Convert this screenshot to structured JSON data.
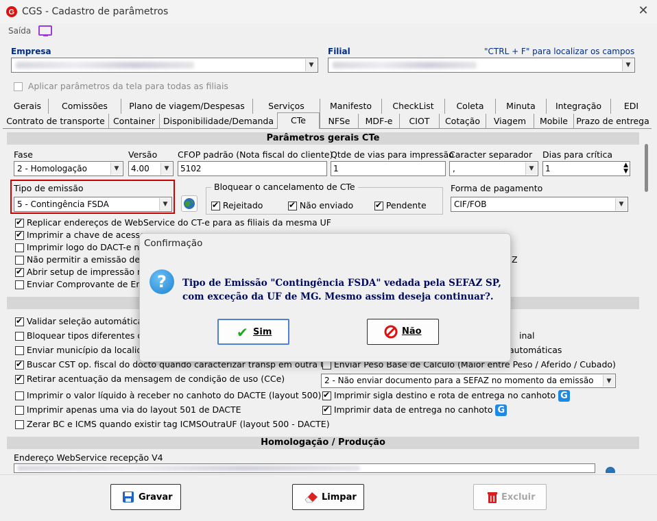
{
  "window": {
    "title": "CGS - Cadastro de parâmetros",
    "close": "✕"
  },
  "menu": {
    "saida": "Saída"
  },
  "empresa": {
    "label": "Empresa"
  },
  "filial": {
    "label": "Filial",
    "hint": "\"CTRL + F\" para localizar os campos"
  },
  "apply_all": {
    "label": "Aplicar parâmetros da tela para todas as filiais"
  },
  "tabs_row1": [
    "Gerais",
    "Comissões",
    "Plano de viagem/Despesas",
    "Serviços",
    "Manifesto",
    "CheckList",
    "Coleta",
    "Minuta",
    "Integração",
    "EDI"
  ],
  "tabs_row2": [
    "Contrato de transporte",
    "Container",
    "Disponibilidade/Demanda",
    "CTe",
    "NFSe",
    "MDF-e",
    "CIOT",
    "Cotação",
    "Viagem",
    "Mobile",
    "Prazo de entrega"
  ],
  "section_cte": "Parâmetros gerais CTe",
  "fase": {
    "label": "Fase",
    "value": "2 - Homologação"
  },
  "versao": {
    "label": "Versão",
    "value": "4.00"
  },
  "cfop": {
    "label": "CFOP padrão (Nota fiscal do cliente)",
    "value": "5102"
  },
  "vias": {
    "label": "Qtde de vias para impressão",
    "value": "1"
  },
  "separador": {
    "label": "Caracter separador",
    "value": ","
  },
  "dias": {
    "label": "Dias para crítica",
    "value": "1"
  },
  "tipo_emissao": {
    "label": "Tipo de emissão",
    "value": "5 - Contingência FSDA"
  },
  "bloquear": {
    "label": "Bloquear o cancelamento de CTe",
    "rejeitado": "Rejeitado",
    "nao_enviado": "Não enviado",
    "pendente": "Pendente"
  },
  "forma_pagamento": {
    "label": "Forma de pagamento",
    "value": "CIF/FOB"
  },
  "checks_top": [
    "Replicar endereços de WebService do CT-e para as filiais da mesma UF",
    "Imprimir a chave de acesso",
    "Imprimir logo do DACT-e na",
    "Não permitir a emissão de C",
    "Abrir setup de impressão no",
    "Enviar Comprovante de Ent"
  ],
  "z_char": "Z",
  "checks_mid_left": [
    "Validar seleção automática",
    "Bloquear tipos diferentes de",
    "Enviar município da localida",
    "Buscar CST op. fiscal do docto quando caracterizar transp em outra UF",
    "Retirar acentuação da mensagem de condição de uso (CCe)",
    "Imprimir o valor líquido à receber no canhoto do DACTE (layout 500)",
    "Imprimir apenas uma via do layout 501 de DACTE",
    "Zerar BC e ICMS quando existir tag ICMSOutraUF (layout 500 - DACTE)"
  ],
  "mid_right": {
    "inal": "inal",
    "automaticas": "automáticas",
    "peso": "Enviar Peso Base de Cálculo (Maior entre Peso / Aferido / Cubado)",
    "combo": "2 - Não enviar documento para a SEFAZ no momento da emissão",
    "sigla": "Imprimir sigla destino e rota de entrega no canhoto",
    "data": "Imprimir data de entrega no canhoto",
    "g": "G"
  },
  "section_homolog": "Homologação / Produção",
  "endereco": {
    "label": "Endereço WebService recepção V4"
  },
  "buttons": {
    "gravar": "Gravar",
    "limpar": "Limpar",
    "excluir": "Excluir"
  },
  "dialog": {
    "title": "Confirmação",
    "icon": "?",
    "message": "Tipo de Emissão \"Contingência FSDA\" vedada pela SEFAZ SP, com exceção da UF de MG. Mesmo assim deseja continuar?.",
    "sim": "Sim",
    "nao": "Não"
  },
  "colors": {
    "accent_blue": "#002c85",
    "highlight_red": "#d00000",
    "dialog_text": "#000a5c"
  }
}
